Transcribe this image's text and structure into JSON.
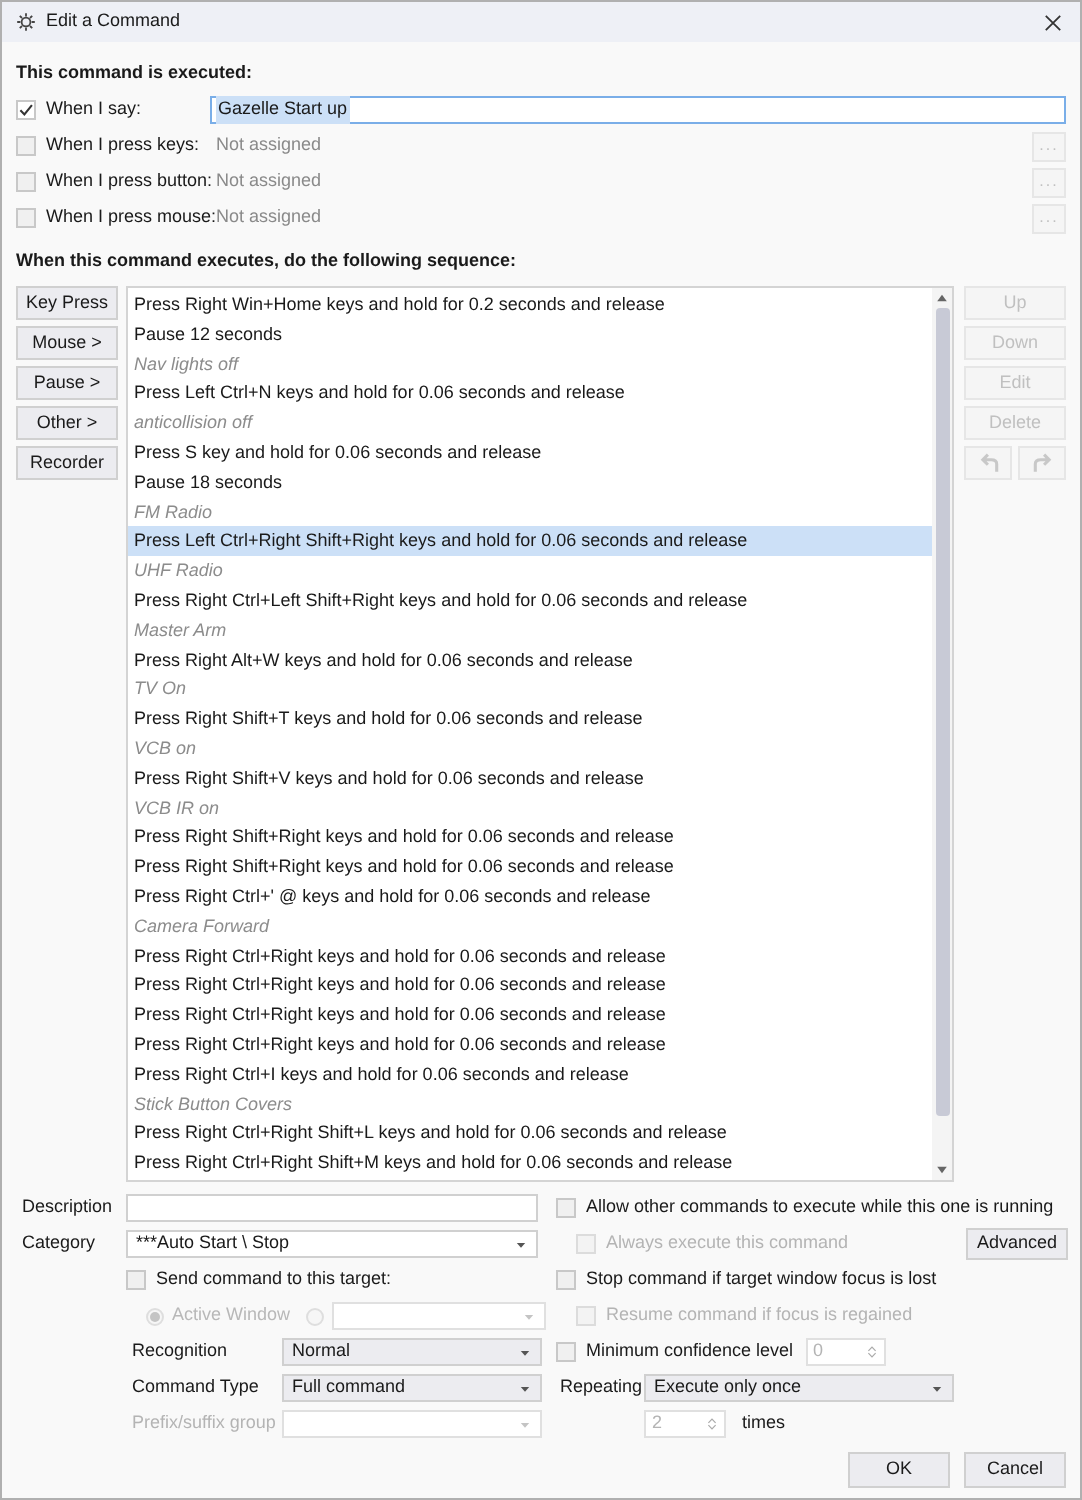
{
  "window": {
    "title": "Edit a Command"
  },
  "trigger_section": {
    "heading": "This command is executed:",
    "triggers": [
      {
        "kind": "text",
        "label": "When I say:",
        "checked": true,
        "value": "Gazelle Start up"
      },
      {
        "kind": "assign",
        "label": "When I press keys:",
        "checked": false,
        "value": "Not assigned",
        "button": "..."
      },
      {
        "kind": "assign",
        "label": "When I press button:",
        "checked": false,
        "value": "Not assigned",
        "button": "..."
      },
      {
        "kind": "assign",
        "label": "When I press mouse:",
        "checked": false,
        "value": "Not assigned",
        "button": "..."
      }
    ]
  },
  "sequence": {
    "heading": "When this command executes, do the following sequence:",
    "add_buttons": [
      "Key Press",
      "Mouse >",
      "Pause >",
      "Other >",
      "Recorder"
    ],
    "items": [
      {
        "kind": "action",
        "text": "Press Right Win+Home keys and hold for 0.2 seconds and release",
        "selected": false
      },
      {
        "kind": "action",
        "text": "Pause 12 seconds",
        "selected": false
      },
      {
        "kind": "comment",
        "text": "Nav lights off",
        "selected": false
      },
      {
        "kind": "action",
        "text": "Press Left Ctrl+N keys and hold for 0.06 seconds and release",
        "selected": false
      },
      {
        "kind": "comment",
        "text": "anticollision off",
        "selected": false
      },
      {
        "kind": "action",
        "text": "Press S key and hold for 0.06 seconds and release",
        "selected": false
      },
      {
        "kind": "action",
        "text": "Pause 18 seconds",
        "selected": false
      },
      {
        "kind": "comment",
        "text": "FM Radio",
        "selected": false
      },
      {
        "kind": "action",
        "text": "Press Left Ctrl+Right Shift+Right keys and hold for 0.06 seconds and release",
        "selected": true
      },
      {
        "kind": "comment",
        "text": "UHF Radio",
        "selected": false
      },
      {
        "kind": "action",
        "text": "Press Right Ctrl+Left Shift+Right keys and hold for 0.06 seconds and release",
        "selected": false
      },
      {
        "kind": "comment",
        "text": "Master Arm",
        "selected": false
      },
      {
        "kind": "action",
        "text": "Press Right Alt+W keys and hold for 0.06 seconds and release",
        "selected": false
      },
      {
        "kind": "comment",
        "text": "TV On",
        "selected": false
      },
      {
        "kind": "action",
        "text": "Press Right Shift+T keys and hold for 0.06 seconds and release",
        "selected": false
      },
      {
        "kind": "comment",
        "text": "VCB on",
        "selected": false
      },
      {
        "kind": "action",
        "text": "Press Right Shift+V keys and hold for 0.06 seconds and release",
        "selected": false
      },
      {
        "kind": "comment",
        "text": "VCB IR on",
        "selected": false
      },
      {
        "kind": "action",
        "text": "Press Right Shift+Right keys and hold for 0.06 seconds and release",
        "selected": false
      },
      {
        "kind": "action",
        "text": "Press Right Shift+Right keys and hold for 0.06 seconds and release",
        "selected": false
      },
      {
        "kind": "action",
        "text": "Press Right Ctrl+' @ keys and hold for 0.06 seconds and release",
        "selected": false
      },
      {
        "kind": "comment",
        "text": "Camera Forward",
        "selected": false
      },
      {
        "kind": "action",
        "text": "Press Right Ctrl+Right keys and hold for 0.06 seconds and release",
        "selected": false
      },
      {
        "kind": "action",
        "text": "Press Right Ctrl+Right keys and hold for 0.06 seconds and release",
        "selected": false
      },
      {
        "kind": "action",
        "text": "Press Right Ctrl+Right keys and hold for 0.06 seconds and release",
        "selected": false
      },
      {
        "kind": "action",
        "text": "Press Right Ctrl+Right keys and hold for 0.06 seconds and release",
        "selected": false
      },
      {
        "kind": "action",
        "text": "Press Right Ctrl+I keys and hold for 0.06 seconds and release",
        "selected": false
      },
      {
        "kind": "comment",
        "text": "Stick Button Covers",
        "selected": false
      },
      {
        "kind": "action",
        "text": "Press Right Ctrl+Right Shift+L keys and hold for 0.06 seconds and release",
        "selected": false
      },
      {
        "kind": "action",
        "text": "Press Right Ctrl+Right Shift+M keys and hold for 0.06 seconds and release",
        "selected": false
      }
    ],
    "edit_buttons": [
      {
        "label": "Up",
        "disabled": true
      },
      {
        "label": "Down",
        "disabled": true
      },
      {
        "label": "Edit",
        "disabled": true
      },
      {
        "label": "Delete",
        "disabled": true
      }
    ],
    "history_buttons": [
      {
        "kind": "undo",
        "disabled": true
      },
      {
        "kind": "redo",
        "disabled": true
      }
    ]
  },
  "options": {
    "description": {
      "label": "Description"
    },
    "category": {
      "label": "Category",
      "value": "***Auto Start \\ Stop"
    },
    "send_to_target": {
      "label": "Send command to this target:",
      "checked": false
    },
    "target_choices": [
      {
        "label": "Active Window",
        "selected": true,
        "disabled": true
      },
      {
        "kind": "window",
        "selected": false,
        "disabled": true
      }
    ],
    "recognition": {
      "label": "Recognition",
      "value": "Normal"
    },
    "command_type": {
      "label": "Command Type",
      "value": "Full command"
    },
    "prefix_group": {
      "label": "Prefix/suffix group",
      "disabled": true
    },
    "allow_other": {
      "label": "Allow other commands to execute while this one is running",
      "checked": false,
      "disabled": false
    },
    "always_execute": {
      "label": "Always execute this command",
      "checked": false,
      "disabled": true
    },
    "stop_if_focus_lost": {
      "label": "Stop command if target window focus is lost",
      "checked": false,
      "disabled": false
    },
    "resume": {
      "label": "Resume command if focus is regained",
      "checked": false,
      "disabled": true
    },
    "min_confidence": {
      "label": "Minimum confidence level",
      "checked": false,
      "value": "0",
      "disabled": true
    },
    "repeating": {
      "label": "Repeating",
      "value": "Execute only once"
    },
    "repeat_count": {
      "value": "2",
      "unit": "times",
      "disabled": true
    },
    "advanced_button": "Advanced"
  },
  "buttons": [
    "OK",
    "Cancel"
  ]
}
